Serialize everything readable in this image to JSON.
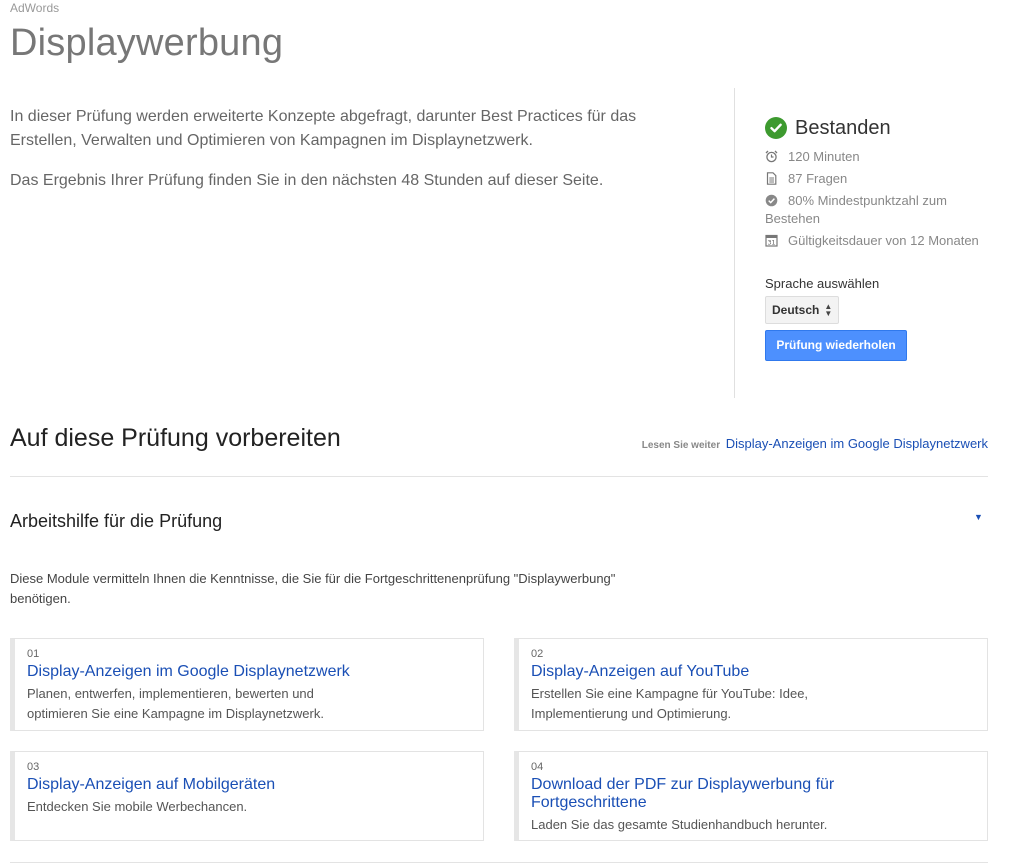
{
  "breadcrumb": "AdWords",
  "page_title": "Displaywerbung",
  "intro": [
    "In dieser Prüfung werden erweiterte Konzepte abgefragt, darunter Best Practices für das Erstellen, Verwalten und Optimieren von Kampagnen im Displaynetzwerk.",
    "Das Ergebnis Ihrer Prüfung finden Sie in den nächsten 48 Stunden auf dieser Seite."
  ],
  "sidebar": {
    "status": "Bestanden",
    "status_icon": "check-circle-icon",
    "status_color": "#3d9a2f",
    "facts": [
      {
        "icon": "alarm-clock-icon",
        "text": "120 Minuten"
      },
      {
        "icon": "document-icon",
        "text": "87 Fragen"
      },
      {
        "icon": "check-badge-icon",
        "text": "80% Mindestpunktzahl zum Bestehen"
      },
      {
        "icon": "calendar-icon",
        "text": "Gültigkeitsdauer von 12 Monaten"
      }
    ],
    "language_label": "Sprache auswählen",
    "language_value": "Deutsch",
    "retake_label": "Prüfung wiederholen",
    "button_color": "#4d90fe"
  },
  "prepare": {
    "title": "Auf diese Prüfung vorbereiten",
    "read_more_label": "Lesen Sie weiter",
    "read_more_link": "Display-Anzeigen im Google Displaynetzwerk"
  },
  "study_guide": {
    "title": "Arbeitshilfe für die Prüfung",
    "toggle": "▼",
    "description": "Diese Module vermitteln Ihnen die Kenntnisse, die Sie für die Fortgeschrittenenprüfung \"Displaywerbung\" benötigen."
  },
  "modules": [
    {
      "num": "01",
      "title": "Display-Anzeigen im Google Displaynetzwerk",
      "desc": "Planen, entwerfen, implementieren, bewerten und optimieren Sie eine Kampagne im Displaynetzwerk."
    },
    {
      "num": "02",
      "title": "Display-Anzeigen auf YouTube",
      "desc": "Erstellen Sie eine Kampagne für YouTube: Idee, Implementierung und Optimierung."
    },
    {
      "num": "03",
      "title": "Display-Anzeigen auf Mobilgeräten",
      "desc": "Entdecken Sie mobile Werbechancen."
    },
    {
      "num": "04",
      "title": "Download der PDF zur Displaywerbung für Fortgeschrittene",
      "desc": "Laden Sie das gesamte Studienhandbuch herunter."
    }
  ],
  "link_color": "#1a4fb5"
}
